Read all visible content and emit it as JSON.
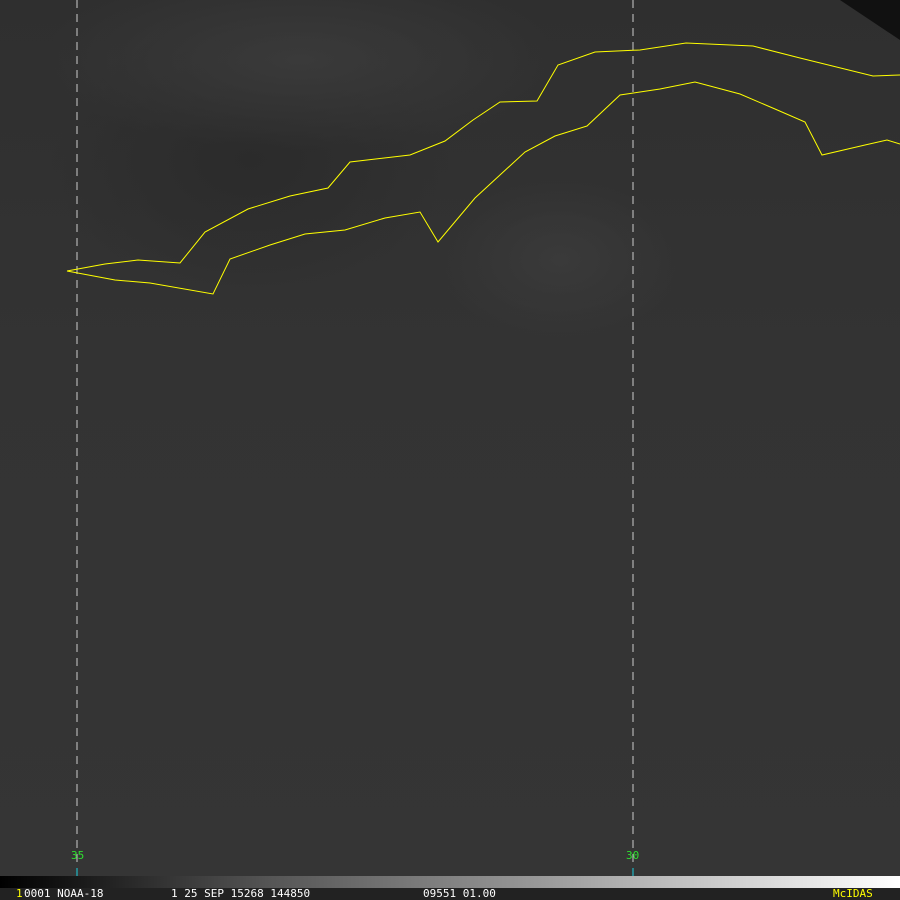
{
  "map": {
    "longitude_labels": [
      "35",
      "30"
    ],
    "coastline_color": "#ffff00",
    "grid_color": "#cccccc",
    "label_color": "#2fe02f"
  },
  "status_bar": {
    "frame_number": "1",
    "station": "0001 NOAA-18",
    "band_date": "1 25 SEP 15268 144850",
    "extra": "09551 01.00",
    "brand": "McIDAS"
  }
}
